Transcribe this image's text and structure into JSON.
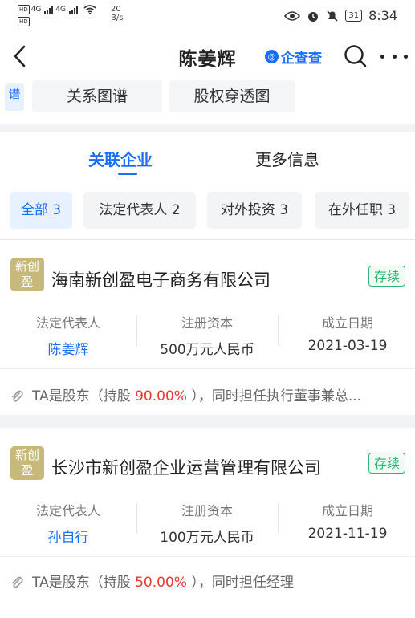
{
  "status_bar": {
    "sim1": "HD",
    "sim2": "HD",
    "net1": "4G",
    "net2": "4G",
    "speed_value": "20",
    "speed_unit": "B/s",
    "battery": "31",
    "time": "8:34"
  },
  "header": {
    "title": "陈姜辉",
    "brand": "企查查"
  },
  "tools": {
    "edge_label": "谱",
    "items": [
      "关系图谱",
      "股权穿透图"
    ]
  },
  "tabs": [
    {
      "label": "关联企业",
      "active": true
    },
    {
      "label": "更多信息",
      "active": false
    }
  ],
  "filters": [
    {
      "label": "全部 3",
      "active": true
    },
    {
      "label": "法定代表人 2",
      "active": false
    },
    {
      "label": "对外投资 3",
      "active": false
    },
    {
      "label": "在外任职 3",
      "active": false
    }
  ],
  "companies": [
    {
      "logo_text": "新创盈",
      "name": "海南新创盈电子商务有限公司",
      "status": "存续",
      "legal_rep_label": "法定代表人",
      "legal_rep": "陈姜辉",
      "capital_label": "注册资本",
      "capital": "500万元人民币",
      "date_label": "成立日期",
      "date": "2021-03-19",
      "note_prefix": "TA是股东（持股 ",
      "note_pct": "90.00%",
      "note_suffix": " ），同时担任执行董事兼总..."
    },
    {
      "logo_text": "新创盈",
      "name": "长沙市新创盈企业运营管理有限公司",
      "status": "存续",
      "legal_rep_label": "法定代表人",
      "legal_rep": "孙自行",
      "capital_label": "注册资本",
      "capital": "100万元人民币",
      "date_label": "成立日期",
      "date": "2021-11-19",
      "note_prefix": "TA是股东（持股 ",
      "note_pct": "50.00%",
      "note_suffix": " ），同时担任经理"
    }
  ],
  "colors": {
    "accent": "#1a6df5",
    "status_green": "#2eb872",
    "percent_red": "#e53935",
    "logo_gold": "#c7b97c"
  }
}
